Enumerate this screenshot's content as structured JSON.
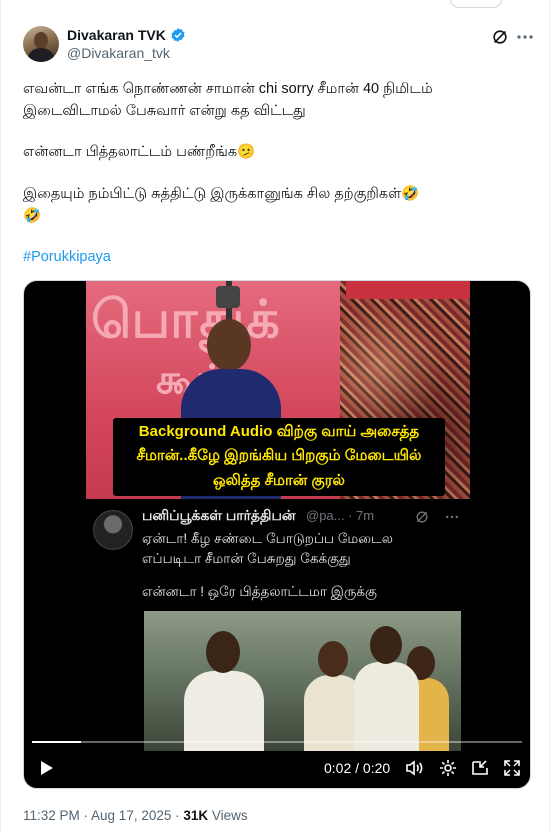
{
  "post": {
    "author_name": "Divakaran TVK",
    "author_handle": "@Divakaran_tvk",
    "text_lines": [
      "எவன்டா எங்க நொண்ணன் சாமான் chi sorry சீமான் 40 நிமிடம்",
      "இடைவிடாமல் பேசுவார் என்று கத விட்டது",
      "என்னடா பித்தலாட்டம் பண்றீங்க🫤",
      "இதையும் நம்பிட்டு சுத்திட்டு இருக்கானுங்க சில தற்குறிகள்🤣",
      "🤣"
    ],
    "hashtag": "#Porukkipaya",
    "timestamp": "11:32 PM · Aug 17, 2025",
    "sep": " · ",
    "views_count": "31K",
    "views_label": " Views"
  },
  "media": {
    "caption_lines": [
      "Background Audio விற்கு வாய் அசைத்த",
      "சீமான்..கீழே இறங்கிய பிறகும் மேடையில்",
      "ஒலித்த சீமான் குரல்"
    ],
    "inner_post": {
      "author_name": "பனிப்பூக்கள் பார்த்திபன்",
      "handle_time": "@pa... · 7m",
      "text_lines": [
        "ஏன்டா! கீழ சண்டை போடுறப்ப மேடைல",
        "எப்படிடா சீமான் பேசுறது கேக்குது",
        "என்னடா ! ஒரே பித்தலாட்டமா இருக்கு"
      ]
    },
    "time_display": "0:02 / 0:20",
    "progress_fraction": 0.1
  },
  "icons": {
    "verified": "verified-badge-icon",
    "grok": "grok-icon",
    "more": "more-icon",
    "play": "play-icon",
    "volume": "volume-icon",
    "settings": "gear-icon",
    "pip": "picture-in-picture-icon",
    "fullscreen": "fullscreen-icon"
  },
  "colors": {
    "link": "#1d9bf0",
    "caption": "#ffe700",
    "muted": "#536471"
  }
}
